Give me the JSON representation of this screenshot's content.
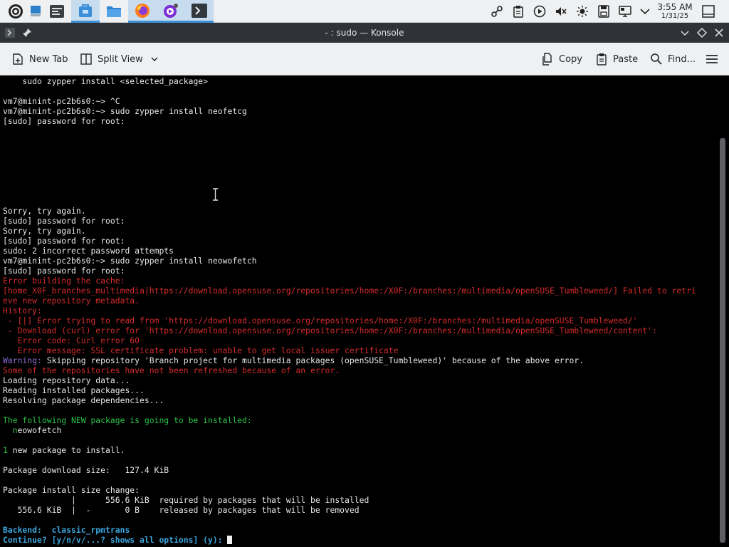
{
  "taskbar": {
    "launchers": [
      {
        "name": "application-launcher-icon"
      },
      {
        "name": "desktop-icon"
      },
      {
        "name": "system-monitor-icon"
      },
      {
        "name": "software-store-icon"
      },
      {
        "name": "file-manager-icon"
      },
      {
        "name": "firefox-icon"
      },
      {
        "name": "media-player-icon"
      },
      {
        "name": "konsole-icon"
      }
    ],
    "tray": [
      "network-icon",
      "clipboard-icon",
      "media-play-icon",
      "volume-muted-icon",
      "brightness-icon",
      "storage-icon",
      "display-icon",
      "tray-expand-icon"
    ],
    "clock": {
      "time": "3:55 AM",
      "date": "1/31/25"
    }
  },
  "window": {
    "title": "- : sudo — Konsole"
  },
  "toolbar": {
    "new_tab": "New Tab",
    "split_view": "Split View",
    "copy": "Copy",
    "paste": "Paste",
    "find": "Find..."
  },
  "terminal": {
    "lines": [
      {
        "segments": [
          {
            "text": "    sudo zypper install <selected_package>",
            "color": "default"
          }
        ]
      },
      {
        "segments": [
          {
            "text": "",
            "color": "default"
          }
        ]
      },
      {
        "segments": [
          {
            "text": "vm7@minint-pc2b6s0:~> ^C",
            "color": "default"
          }
        ]
      },
      {
        "segments": [
          {
            "text": "vm7@minint-pc2b6s0:~> sudo zypper install neofetcg",
            "color": "default"
          }
        ]
      },
      {
        "segments": [
          {
            "text": "[sudo] password for root:",
            "color": "default"
          }
        ]
      },
      {
        "segments": [
          {
            "text": "",
            "color": "default"
          }
        ]
      },
      {
        "segments": [
          {
            "text": "",
            "color": "default"
          }
        ]
      },
      {
        "segments": [
          {
            "text": "",
            "color": "default"
          }
        ]
      },
      {
        "segments": [
          {
            "text": "",
            "color": "default"
          }
        ]
      },
      {
        "segments": [
          {
            "text": "",
            "color": "default"
          }
        ]
      },
      {
        "segments": [
          {
            "text": "",
            "color": "default"
          }
        ]
      },
      {
        "segments": [
          {
            "text": "",
            "color": "default"
          }
        ]
      },
      {
        "segments": [
          {
            "text": "",
            "color": "default"
          }
        ]
      },
      {
        "segments": [
          {
            "text": "Sorry, try again.",
            "color": "default"
          }
        ]
      },
      {
        "segments": [
          {
            "text": "[sudo] password for root:",
            "color": "default"
          }
        ]
      },
      {
        "segments": [
          {
            "text": "Sorry, try again.",
            "color": "default"
          }
        ]
      },
      {
        "segments": [
          {
            "text": "[sudo] password for root:",
            "color": "default"
          }
        ]
      },
      {
        "segments": [
          {
            "text": "sudo: 2 incorrect password attempts",
            "color": "default"
          }
        ]
      },
      {
        "segments": [
          {
            "text": "vm7@minint-pc2b6s0:~> sudo zypper install neowofetch",
            "color": "default"
          }
        ]
      },
      {
        "segments": [
          {
            "text": "[sudo] password for root:",
            "color": "default"
          }
        ]
      },
      {
        "segments": [
          {
            "text": "Error building the cache:",
            "color": "red"
          }
        ]
      },
      {
        "segments": [
          {
            "text": "[home_X0F_branches_multimedia|https://download.opensuse.org/repositories/home:/X0F:/branches:/multimedia/openSUSE_Tumbleweed/] Failed to retri",
            "color": "red"
          }
        ]
      },
      {
        "segments": [
          {
            "text": "eve new repository metadata.",
            "color": "red"
          }
        ]
      },
      {
        "segments": [
          {
            "text": "History:",
            "color": "red"
          }
        ]
      },
      {
        "segments": [
          {
            "text": " - [|] Error trying to read from 'https://download.opensuse.org/repositories/home:/X0F:/branches:/multimedia/openSUSE_Tumbleweed/'",
            "color": "red"
          }
        ]
      },
      {
        "segments": [
          {
            "text": " - Download (curl) error for 'https://download.opensuse.org/repositories/home:/X0F:/branches:/multimedia/openSUSE_Tumbleweed/content':",
            "color": "red"
          }
        ]
      },
      {
        "segments": [
          {
            "text": "   Error code: Curl error 60",
            "color": "red"
          }
        ]
      },
      {
        "segments": [
          {
            "text": "   Error message: SSL certificate problem: unable to get local issuer certificate",
            "color": "red"
          }
        ]
      },
      {
        "segments": [
          {
            "text": "Warning:",
            "color": "purple"
          },
          {
            "text": " Skipping repository 'Branch project for multimedia packages (openSUSE_Tumbleweed)' because of the above error.",
            "color": "default"
          }
        ]
      },
      {
        "segments": [
          {
            "text": "Some of the repositories have not been refreshed because of an error.",
            "color": "red"
          }
        ]
      },
      {
        "segments": [
          {
            "text": "Loading repository data...",
            "color": "default"
          }
        ]
      },
      {
        "segments": [
          {
            "text": "Reading installed packages...",
            "color": "default"
          }
        ]
      },
      {
        "segments": [
          {
            "text": "Resolving package dependencies...",
            "color": "default"
          }
        ]
      },
      {
        "segments": [
          {
            "text": "",
            "color": "default"
          }
        ]
      },
      {
        "segments": [
          {
            "text": "The following NEW package is going to be installed:",
            "color": "green"
          }
        ]
      },
      {
        "segments": [
          {
            "text": "  ",
            "color": "default"
          },
          {
            "text": "n",
            "color": "green"
          },
          {
            "text": "eowofetch",
            "color": "default"
          }
        ]
      },
      {
        "segments": [
          {
            "text": "",
            "color": "default"
          }
        ]
      },
      {
        "segments": [
          {
            "text": "1",
            "color": "green"
          },
          {
            "text": " new package to install.",
            "color": "default"
          }
        ]
      },
      {
        "segments": [
          {
            "text": "",
            "color": "default"
          }
        ]
      },
      {
        "segments": [
          {
            "text": "Package download size:   127.4 KiB",
            "color": "default"
          }
        ]
      },
      {
        "segments": [
          {
            "text": "",
            "color": "default"
          }
        ]
      },
      {
        "segments": [
          {
            "text": "Package install size change:",
            "color": "default"
          }
        ]
      },
      {
        "segments": [
          {
            "text": "              |      556.6 KiB  required by packages that will be installed",
            "color": "default"
          }
        ]
      },
      {
        "segments": [
          {
            "text": "   556.6 KiB  |  -       0 B    released by packages that will be removed",
            "color": "default"
          }
        ]
      },
      {
        "segments": [
          {
            "text": "",
            "color": "default"
          }
        ]
      },
      {
        "segments": [
          {
            "text": "Backend:  classic_rpmtrans",
            "color": "blue"
          }
        ]
      },
      {
        "segments": [
          {
            "text": "Continue? [y/n/v/...? shows all options] (y): ",
            "color": "blue"
          }
        ],
        "cursor": true
      }
    ]
  }
}
